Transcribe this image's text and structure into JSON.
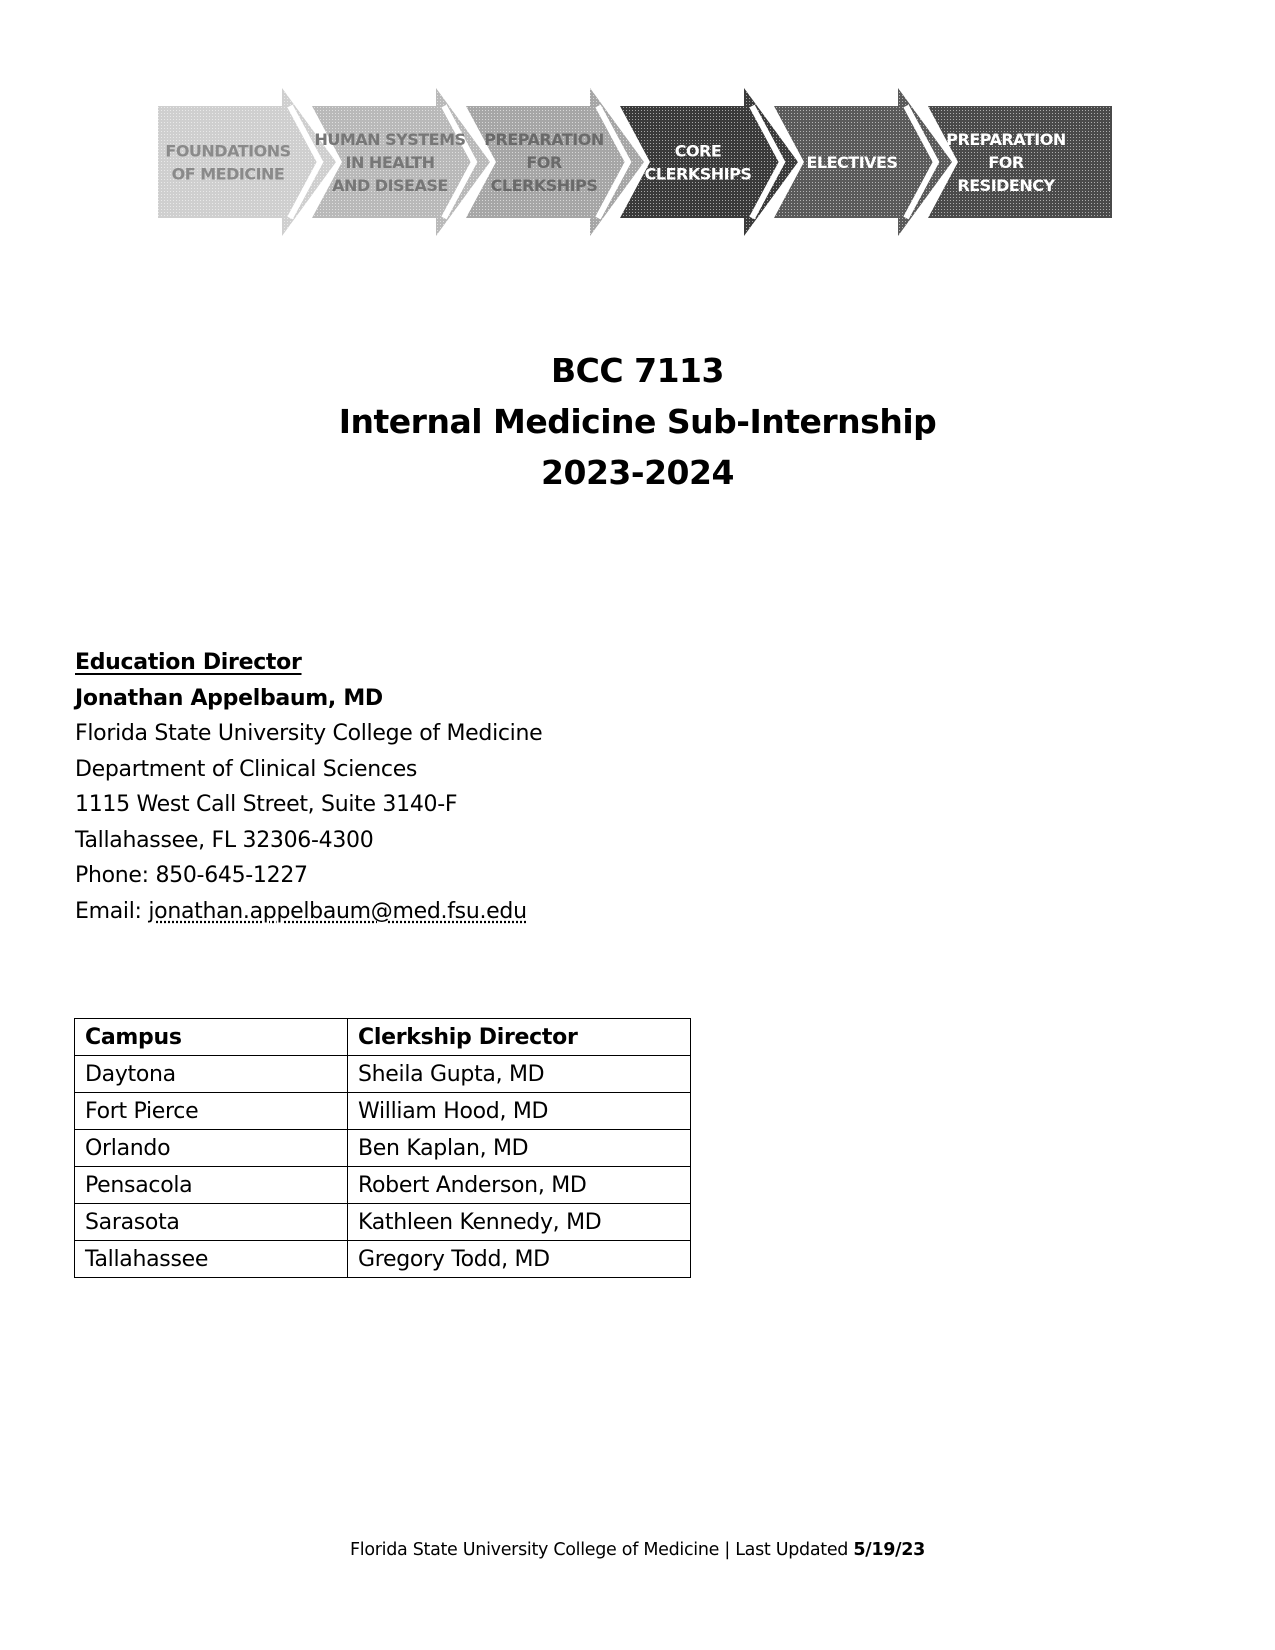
{
  "banner": {
    "stages": [
      {
        "lines": [
          "FOUNDATIONS",
          "OF MEDICINE"
        ],
        "shade": "#cfcfcf",
        "text_color": "#8a8a8a"
      },
      {
        "lines": [
          "HUMAN SYSTEMS",
          "IN HEALTH",
          "AND DISEASE"
        ],
        "shade": "#b9b9b9",
        "text_color": "#777777"
      },
      {
        "lines": [
          "PREPARATION",
          "FOR",
          "CLERKSHIPS"
        ],
        "shade": "#a6a6a6",
        "text_color": "#6a6a6a"
      },
      {
        "lines": [
          "CORE",
          "CLERKSHIPS"
        ],
        "shade": "#3a3a3a",
        "text_color": "#ffffff"
      },
      {
        "lines": [
          "ELECTIVES"
        ],
        "shade": "#5a5a5a",
        "text_color": "#ffffff"
      },
      {
        "lines": [
          "PREPARATION",
          "FOR",
          "RESIDENCY"
        ],
        "shade": "#4a4a4a",
        "text_color": "#ffffff"
      }
    ]
  },
  "title": {
    "course_code": "BCC 7113",
    "course_name": "Internal Medicine Sub-Internship",
    "academic_year": "2023-2024"
  },
  "contact": {
    "heading": "Education Director",
    "name": "Jonathan Appelbaum, MD",
    "institution": "Florida State University College of Medicine",
    "department": "Department of Clinical Sciences",
    "address": "1115 West Call Street, Suite 3140-F",
    "city_state_zip": "Tallahassee, FL 32306-4300",
    "phone_label": "Phone: ",
    "phone": "850-645-1227",
    "email_label": "Email: ",
    "email": "jonathan.appelbaum@med.fsu.edu"
  },
  "directors_table": {
    "headers": [
      "Campus",
      "Clerkship Director"
    ],
    "rows": [
      [
        "Daytona",
        "Sheila Gupta, MD"
      ],
      [
        "Fort Pierce",
        "William Hood, MD"
      ],
      [
        "Orlando",
        "Ben Kaplan, MD"
      ],
      [
        "Pensacola",
        "Robert Anderson, MD"
      ],
      [
        "Sarasota",
        "Kathleen Kennedy, MD"
      ],
      [
        "Tallahassee",
        "Gregory Todd, MD"
      ]
    ]
  },
  "footer": {
    "text": "Florida State University College of Medicine | Last Updated ",
    "date": "5/19/23"
  }
}
